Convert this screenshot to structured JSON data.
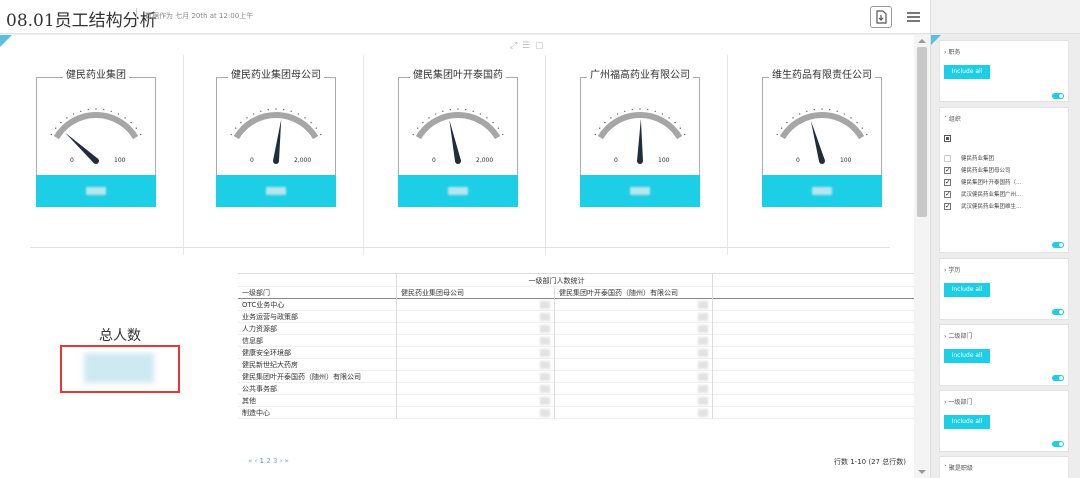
{
  "header": {
    "title": "08.01员工结构分析",
    "data_as_of": "数据作为 七月 20th at 12:00上午"
  },
  "gauges": [
    {
      "title": "健民药业集团",
      "min": "0",
      "max": "100",
      "max_value": 100,
      "fraction": 0.1
    },
    {
      "title": "健民药业集团母公司",
      "min": "0",
      "max": "2,000",
      "max_value": 2000,
      "fraction": 0.56
    },
    {
      "title": "健民集团叶开泰国药",
      "min": "0",
      "max": "2,000",
      "max_value": 2000,
      "fraction": 0.4
    },
    {
      "title": "广州福高药业有限公司",
      "min": "0",
      "max": "100",
      "max_value": 100,
      "fraction": 0.51
    },
    {
      "title": "维生药品有限责任公司",
      "min": "0",
      "max": "100",
      "max_value": 100,
      "fraction": 0.37
    }
  ],
  "total": {
    "label": "总人数"
  },
  "table": {
    "group_header": "一级部门人数统计",
    "columns": [
      "一级部门",
      "健民药业集团母公司",
      "健民集团叶开泰国药（随州）有限公司"
    ],
    "rows": [
      "OTC业务中心",
      "业务运营与政策部",
      "人力资源部",
      "信息部",
      "健康安全环境部",
      "健民新世纪大药房",
      "健民集团叶开泰国药（随州）有限公司",
      "公共事务部",
      "其他",
      "制造中心"
    ],
    "pager": {
      "prefix": "« ‹",
      "pages": [
        "1",
        "2",
        "3"
      ],
      "suffix": "› »"
    },
    "row_count": "行数 1-10 (27 总行数)"
  },
  "filters": [
    {
      "name": "职务",
      "include_label": "Include all"
    },
    {
      "name": "组织",
      "options": [
        {
          "label": "健民药业集团",
          "checked": false
        },
        {
          "label": "健民药业集团母公司",
          "checked": true
        },
        {
          "label": "健民集团叶开泰国药（...",
          "checked": true
        },
        {
          "label": "武汉健民药业集团广州...",
          "checked": true
        },
        {
          "label": "武汉健民药业集团维生...",
          "checked": true
        }
      ]
    },
    {
      "name": "学历",
      "include_label": "Include all"
    },
    {
      "name": "二级部门",
      "include_label": "Include all"
    },
    {
      "name": "一级部门",
      "include_label": "Include all"
    },
    {
      "name": "聚是职级"
    }
  ],
  "colors": {
    "accent": "#1ccee6",
    "needle": "#1f2d3d",
    "gauge_arc": "#a6a6a6",
    "highlight_box": "#e53935"
  }
}
